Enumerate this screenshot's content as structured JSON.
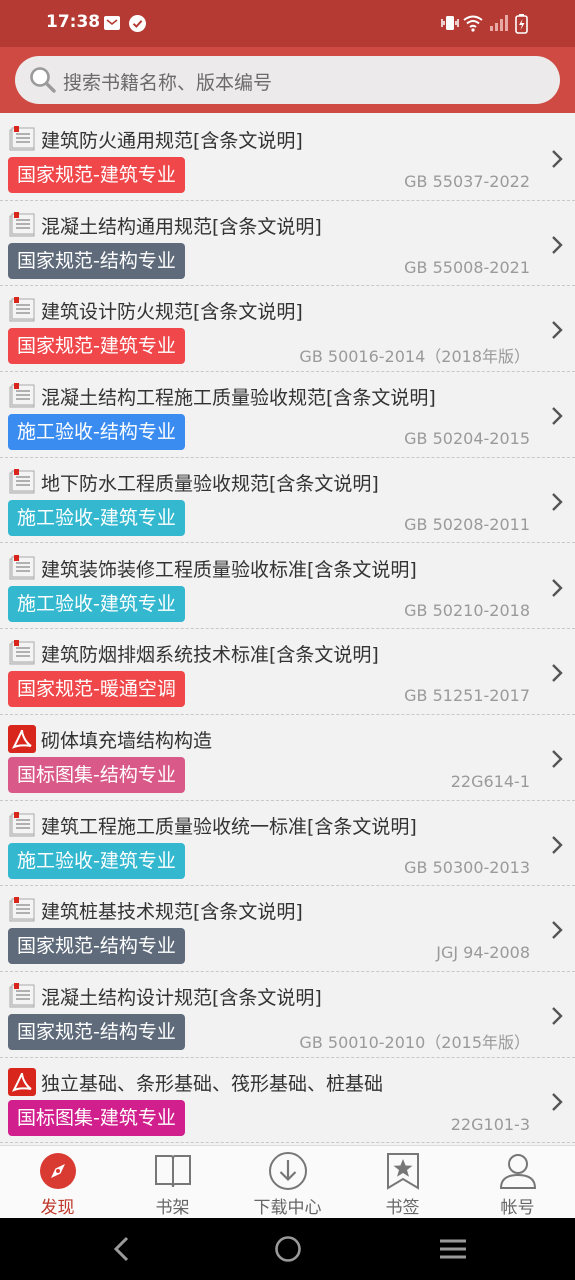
{
  "status": {
    "time": "17:38"
  },
  "search": {
    "placeholder": "搜索书籍名称、版本编号"
  },
  "colors": {
    "red": "#f0474a",
    "slate": "#5f6b7a",
    "blue": "#3b8cf0",
    "cyan": "#33b8d0",
    "pink": "#d95a88",
    "magenta": "#d21f8e"
  },
  "items": [
    {
      "icon": "doc-icon",
      "title": "建筑防火通用规范[含条文说明]",
      "tag": "国家规范-建筑专业",
      "tag_color": "#f0474a",
      "code": "GB 55037-2022"
    },
    {
      "icon": "doc-icon",
      "title": "混凝土结构通用规范[含条文说明]",
      "tag": "国家规范-结构专业",
      "tag_color": "#5f6b7a",
      "code": "GB 55008-2021"
    },
    {
      "icon": "doc-icon",
      "title": "建筑设计防火规范[含条文说明]",
      "tag": "国家规范-建筑专业",
      "tag_color": "#f0474a",
      "code": "GB 50016-2014（2018年版）"
    },
    {
      "icon": "doc-icon",
      "title": "混凝土结构工程施工质量验收规范[含条文说明]",
      "tag": "施工验收-结构专业",
      "tag_color": "#3b8cf0",
      "code": "GB 50204-2015"
    },
    {
      "icon": "doc-icon",
      "title": "地下防水工程质量验收规范[含条文说明]",
      "tag": "施工验收-建筑专业",
      "tag_color": "#33b8d0",
      "code": "GB 50208-2011"
    },
    {
      "icon": "doc-icon",
      "title": "建筑装饰装修工程质量验收标准[含条文说明]",
      "tag": "施工验收-建筑专业",
      "tag_color": "#33b8d0",
      "code": "GB 50210-2018"
    },
    {
      "icon": "doc-icon",
      "title": "建筑防烟排烟系统技术标准[含条文说明]",
      "tag": "国家规范-暖通空调",
      "tag_color": "#f0474a",
      "code": "GB 51251-2017"
    },
    {
      "icon": "pdf-icon",
      "title": "砌体填充墙结构构造",
      "tag": "国标图集-结构专业",
      "tag_color": "#d95a88",
      "code": "22G614-1"
    },
    {
      "icon": "doc-icon",
      "title": "建筑工程施工质量验收统一标准[含条文说明]",
      "tag": "施工验收-建筑专业",
      "tag_color": "#33b8d0",
      "code": "GB 50300-2013"
    },
    {
      "icon": "doc-icon",
      "title": "建筑桩基技术规范[含条文说明]",
      "tag": "国家规范-结构专业",
      "tag_color": "#5f6b7a",
      "code": "JGJ 94-2008"
    },
    {
      "icon": "doc-icon",
      "title": "混凝土结构设计规范[含条文说明]",
      "tag": "国家规范-结构专业",
      "tag_color": "#5f6b7a",
      "code": "GB 50010-2010（2015年版）"
    },
    {
      "icon": "pdf-icon",
      "title": "独立基础、条形基础、筏形基础、桩基础",
      "tag": "国标图集-建筑专业",
      "tag_color": "#d21f8e",
      "code": "22G101-3"
    }
  ],
  "tabs": [
    {
      "label": "发现",
      "icon": "compass-icon",
      "active": true
    },
    {
      "label": "书架",
      "icon": "book-icon",
      "active": false
    },
    {
      "label": "下载中心",
      "icon": "download-icon",
      "active": false
    },
    {
      "label": "书签",
      "icon": "bookmark-icon",
      "active": false
    },
    {
      "label": "帐号",
      "icon": "user-icon",
      "active": false
    }
  ]
}
